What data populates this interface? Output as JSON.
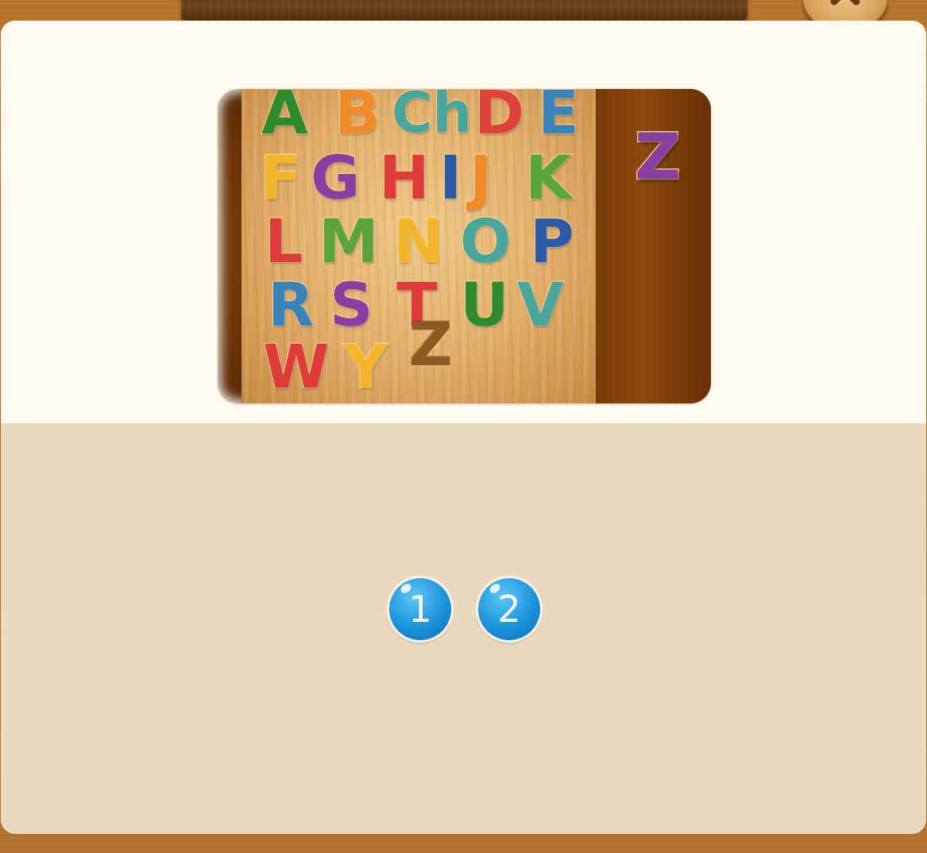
{
  "banner": {
    "title": ""
  },
  "puzzle": {
    "placed_letters": [
      {
        "char": "A",
        "color": "#2f8a2c"
      },
      {
        "char": "B",
        "color": "#f08a2a"
      },
      {
        "char": "Ch",
        "color": "#4aa59a"
      },
      {
        "char": "D",
        "color": "#e0423a"
      },
      {
        "char": "E",
        "color": "#3a83b8"
      },
      {
        "char": "F",
        "color": "#f5b52b"
      },
      {
        "char": "G",
        "color": "#8a3fa0"
      },
      {
        "char": "H",
        "color": "#df3b3b"
      },
      {
        "char": "I",
        "color": "#2b5aa6"
      },
      {
        "char": "J",
        "color": "#f08a2a"
      },
      {
        "char": "K",
        "color": "#5aa43a"
      },
      {
        "char": "L",
        "color": "#df3b3b"
      },
      {
        "char": "M",
        "color": "#5aa43a"
      },
      {
        "char": "N",
        "color": "#f5b52b"
      },
      {
        "char": "O",
        "color": "#4aa59a"
      },
      {
        "char": "P",
        "color": "#2b5aa6"
      },
      {
        "char": "R",
        "color": "#3a83b8"
      },
      {
        "char": "S",
        "color": "#8a3fa0"
      },
      {
        "char": "T",
        "color": "#df3b3b"
      },
      {
        "char": "U",
        "color": "#2f8a2c"
      },
      {
        "char": "V",
        "color": "#4aa59a"
      },
      {
        "char": "W",
        "color": "#df3b3b"
      },
      {
        "char": "Y",
        "color": "#f5b52b"
      }
    ],
    "empty_slot": "Z",
    "loose_piece": {
      "char": "Z",
      "color": "#8a3fa0"
    }
  },
  "levels": [
    "1",
    "2"
  ],
  "icons": {
    "close": "close-x-icon"
  }
}
